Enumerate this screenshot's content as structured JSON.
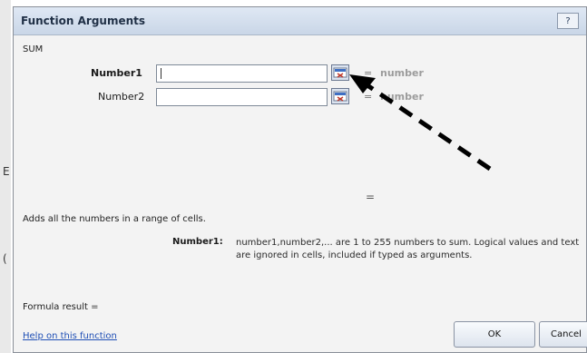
{
  "dialog": {
    "title": "Function Arguments",
    "help_button": "?",
    "function_name": "SUM",
    "arguments": [
      {
        "label": "Number1",
        "value": "",
        "equals": "=",
        "hint": "number"
      },
      {
        "label": "Number2",
        "value": "",
        "equals": "=",
        "hint": "number"
      }
    ],
    "result_equals": "=",
    "description": "Adds all the numbers in a range of cells.",
    "param_name": "Number1:",
    "param_description": "number1,number2,... are 1 to 255 numbers to sum. Logical values and text are ignored in cells, included if typed as arguments.",
    "formula_result": "Formula result =",
    "help_link": "Help on this function",
    "ok_label": "OK",
    "cancel_label": "Cancel"
  },
  "background": {
    "letters": [
      "E",
      "("
    ]
  },
  "annotation": {
    "arrow_color": "#000000"
  }
}
